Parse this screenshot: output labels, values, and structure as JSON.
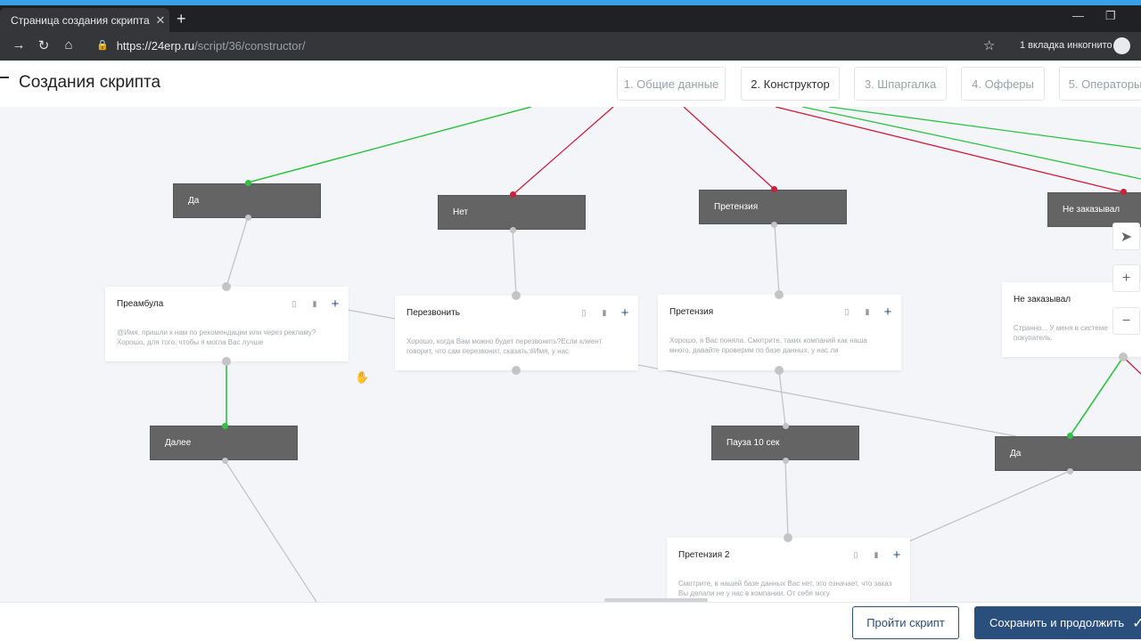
{
  "browser": {
    "tab_title": "Страница создания скрипта",
    "tab_close": "✕",
    "new_tab": "+",
    "url_host": "https://24erp.ru",
    "url_path": "/script/36/constructor/",
    "incognito_label": "1 вкладка инкогнито"
  },
  "header": {
    "title": "Создания скрипта",
    "steps": [
      {
        "label": "1. Общие данные",
        "active": false
      },
      {
        "label": "2. Конструктор",
        "active": true
      },
      {
        "label": "3. Шпаргалка",
        "active": false
      },
      {
        "label": "4. Офферы",
        "active": false
      },
      {
        "label": "5. Операторы",
        "active": false
      }
    ]
  },
  "canvas": {
    "answers": {
      "da_top": "Да",
      "net": "Нет",
      "pretenziya_answer": "Претензия",
      "ne_zakazyval_answer": "Не заказывал",
      "dalee": "Далее",
      "pauza": "Пауза 10 сек",
      "da_right": "Да"
    },
    "cards": {
      "preambula": {
        "title": "Преамбула",
        "body": "@Имя, пришли к нам по рекомендации или через рекламу? Хорошо, для того, чтобы я могла Вас лучше"
      },
      "perezvonit": {
        "title": "Перезвонить",
        "body": "Хорошо, когда Вам можно будет перезвонить?Если клиент говорит, что сам перезвонит, сказать:#Имя, у нас"
      },
      "pretenziya": {
        "title": "Претензия",
        "body": "Хорошо, я Вас поняла. Смотрите, таких компаний как наша много, давайте проверим по базе данных, у нас ли"
      },
      "ne_zakazyval": {
        "title": "Не заказывал",
        "body": "Странно... У меня в системе покупатель."
      },
      "pretenziya2": {
        "title": "Претензия 2",
        "body": "Смотрите, в нашей базе данных Вас нет, это означает, что заказ Вы делали не у нас в компании. От себя могу"
      }
    },
    "colors": {
      "positive_link": "#2fc244",
      "negative_link": "#cc1f3a",
      "neutral_link": "#c4c4c4"
    }
  },
  "footer": {
    "run_label": "Пройти скрипт",
    "save_label": "Сохранить и продолжить"
  }
}
